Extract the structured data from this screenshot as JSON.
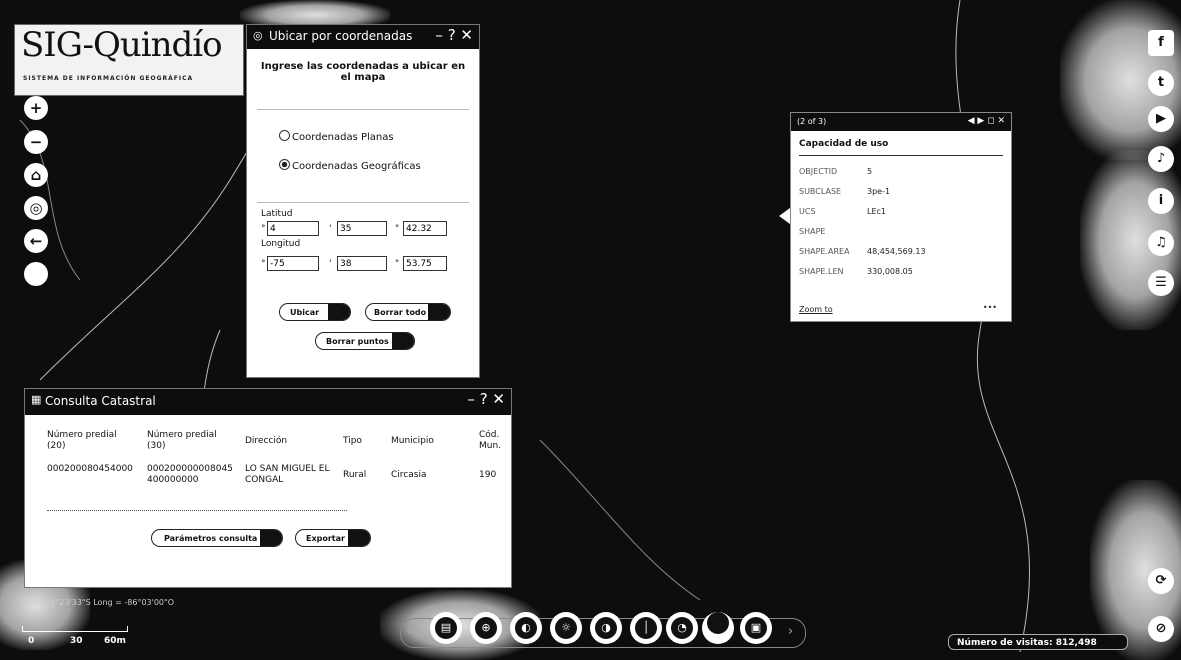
{
  "logo": {
    "title": "SIG-Quindío",
    "subtitle": "SISTEMA DE INFORMACIÓN GEOGRÁFICA"
  },
  "nav": [
    {
      "name": "zoom-in-button",
      "glyph": "+"
    },
    {
      "name": "zoom-out-button",
      "glyph": "−"
    },
    {
      "name": "home-button",
      "glyph": "⌂"
    },
    {
      "name": "locate-button",
      "glyph": "◎"
    },
    {
      "name": "back-button",
      "glyph": "←"
    },
    {
      "name": "blank-button",
      "glyph": ""
    }
  ],
  "ubicar": {
    "title": "Ubicar por coordenadas",
    "controls": "– ? ✕",
    "instruction": "Ingrese las coordenadas a ubicar en el mapa",
    "option_planas": "Coordenadas Planas",
    "option_geo": "Coordenadas Geográficas",
    "selected": "geo",
    "latitud_label": "Latitud",
    "longitud_label": "Longitud",
    "lat": {
      "deg": "4",
      "min": "35",
      "sec": "42.32"
    },
    "lon": {
      "deg": "-75",
      "min": "38",
      "sec": "53.75"
    },
    "btn_ubicar": "Ubicar",
    "btn_borrar_todo": "Borrar todo",
    "btn_borrar_puntos": "Borrar puntos"
  },
  "popup": {
    "counter": "(2 of 3)",
    "controls": "◀ ▶ ◻ ✕",
    "title": "Capacidad de uso",
    "rows": [
      {
        "key": "OBJECTID",
        "value": "5"
      },
      {
        "key": "SUBCLASE",
        "value": "3pe-1"
      },
      {
        "key": "UCS",
        "value": "LEc1"
      },
      {
        "key": "SHAPE",
        "value": ""
      },
      {
        "key": "SHAPE.AREA",
        "value": "48,454,569.13"
      },
      {
        "key": "SHAPE.LEN",
        "value": "330,008.05"
      }
    ],
    "zoom_label": "Zoom to",
    "more": "•••"
  },
  "catastral": {
    "title": "Consulta Catastral",
    "controls": "– ? ✕",
    "headers": [
      "Número predial (20)",
      "Número predial (30)",
      "Dirección",
      "Tipo",
      "Municipio",
      "Cód. Mun."
    ],
    "row": [
      "000200080454000",
      "000200000008045400000000",
      "LO SAN MIGUEL EL CONGAL",
      "Rural",
      "Circasia",
      "190"
    ],
    "btn_parametros": "Parámetros consulta",
    "btn_exportar": "Exportar"
  },
  "status": {
    "coords": "Lat = 4°23'33\"S Long = -86°03'00\"O",
    "scale_labels": [
      "0",
      "30",
      "60m"
    ]
  },
  "social": [
    "f",
    "t",
    "▶",
    "♪",
    "i",
    "♫",
    "☰",
    "⟳",
    "⊘"
  ],
  "toolbar": {
    "prev": "‹",
    "next": "›",
    "tools": [
      "▤",
      "⊕",
      "◐",
      "☼",
      "◑",
      "│",
      "◔",
      "",
      "▣"
    ]
  },
  "visits": {
    "label": "Número de visitas:",
    "value": "812,498"
  }
}
